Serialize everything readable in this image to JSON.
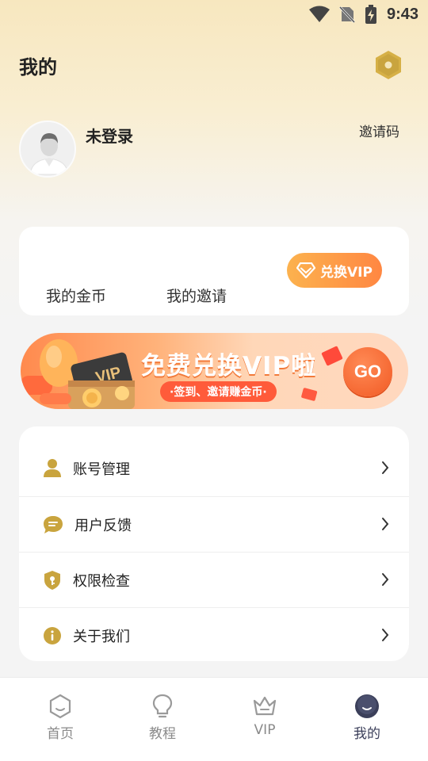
{
  "status_bar": {
    "time": "9:43"
  },
  "header": {
    "title": "我的"
  },
  "profile": {
    "username": "未登录",
    "invite_code_label": "邀请码"
  },
  "wallet": {
    "coins_label": "我的金币",
    "invites_label": "我的邀请",
    "vip_button_label": "兑换VIP"
  },
  "banner": {
    "headline": "免费兑换VIP啦",
    "subline": "·签到、邀请赚金币·",
    "go_label": "GO"
  },
  "menu": {
    "items": [
      {
        "label": "账号管理",
        "icon": "user-icon"
      },
      {
        "label": "用户反馈",
        "icon": "chat-icon"
      },
      {
        "label": "权限检查",
        "icon": "shield-icon"
      },
      {
        "label": "关于我们",
        "icon": "info-icon"
      }
    ]
  },
  "tabbar": {
    "tabs": [
      {
        "label": "首页",
        "icon": "hexagon-icon"
      },
      {
        "label": "教程",
        "icon": "lightbulb-icon"
      },
      {
        "label": "VIP",
        "icon": "crown-icon"
      },
      {
        "label": "我的",
        "icon": "profile-face-icon",
        "active": true
      }
    ]
  },
  "colors": {
    "accent_gold": "#c9a43e",
    "vip_orange": "#ff8742",
    "active_tab": "#3b3f5a",
    "inactive_tab": "#8a8a8a"
  }
}
